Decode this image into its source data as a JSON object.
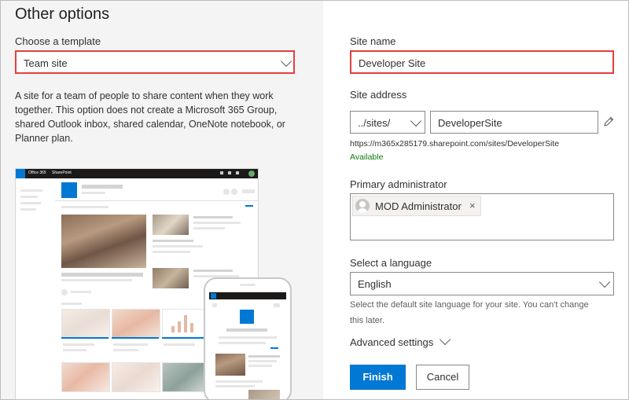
{
  "panel": {
    "title": "Other options"
  },
  "template": {
    "label": "Choose a template",
    "selected": "Team site",
    "description": "A site for a team of people to share content when they work together. This option does not create a Microsoft 365 Group, shared Outlook inbox, shared calendar, OneNote notebook, or Planner plan."
  },
  "preview": {
    "bar_app": "Office 365",
    "bar_site": "SharePoint"
  },
  "site_name": {
    "label": "Site name",
    "value": "Developer Site"
  },
  "site_address": {
    "label": "Site address",
    "prefix": "../sites/",
    "value": "DeveloperSite",
    "full_url": "https://m365x285179.sharepoint.com/sites/DeveloperSite",
    "status": "Available"
  },
  "admin": {
    "label": "Primary administrator",
    "person": "MOD Administrator",
    "remove_glyph": "×"
  },
  "language": {
    "label": "Select a language",
    "selected": "English",
    "hint": "Select the default site language for your site. You can't change this later."
  },
  "advanced": {
    "label": "Advanced settings"
  },
  "actions": {
    "finish": "Finish",
    "cancel": "Cancel"
  },
  "colors": {
    "accent": "#0078d4",
    "highlight": "#e3403b",
    "available": "#107c10"
  },
  "icons": [
    "chevron-down-icon",
    "edit-pencil-icon",
    "remove-icon",
    "person-avatar-icon",
    "waffle-icon"
  ]
}
